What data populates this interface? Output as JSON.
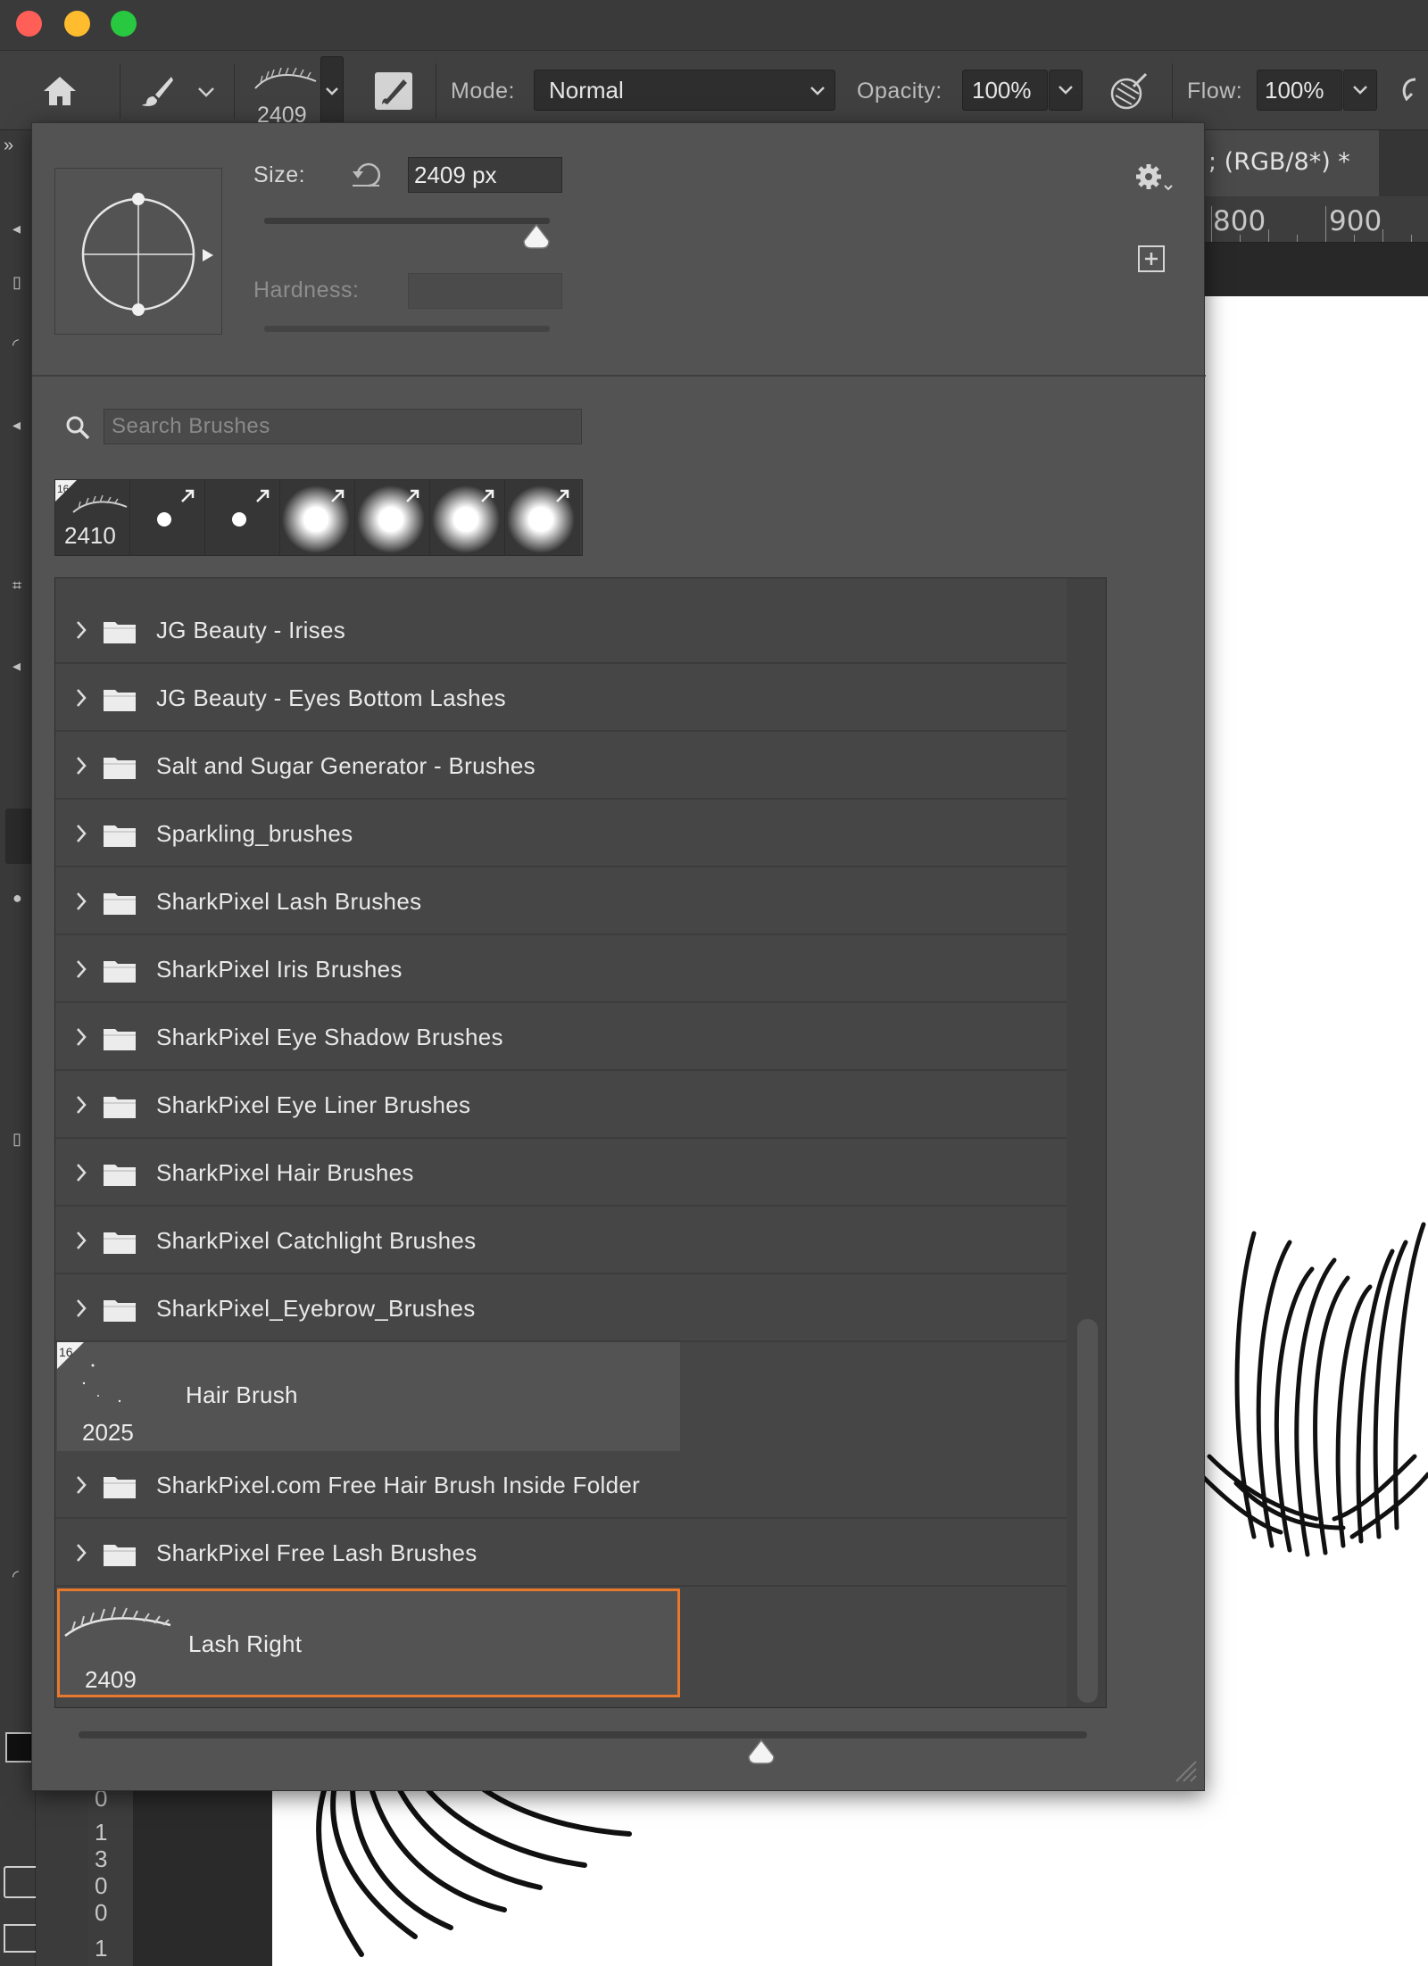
{
  "window": {
    "traffic_lights": [
      "close",
      "minimize",
      "zoom"
    ]
  },
  "options_bar": {
    "brush_size_thumb": "2409",
    "mode_label": "Mode:",
    "mode_value": "Normal",
    "opacity_label": "Opacity:",
    "opacity_value": "100%",
    "flow_label": "Flow:",
    "flow_value": "100%"
  },
  "document": {
    "tab_title": "; (RGB/8*) *",
    "ruler_800": "800",
    "ruler_900": "900",
    "vruler_digits": [
      "0",
      "1",
      "3",
      "0",
      "0",
      "1"
    ]
  },
  "brush_panel": {
    "size_label": "Size:",
    "size_value": "2409 px",
    "hardness_label": "Hardness:",
    "hardness_value": "",
    "search_placeholder": "Search Brushes",
    "recent_brushes": [
      {
        "size": "2410",
        "kind": "lash"
      },
      {
        "size": "",
        "kind": "small-round"
      },
      {
        "size": "",
        "kind": "small-round"
      },
      {
        "size": "",
        "kind": "soft-round"
      },
      {
        "size": "",
        "kind": "soft-round"
      },
      {
        "size": "",
        "kind": "soft-round"
      },
      {
        "size": "",
        "kind": "soft-round"
      }
    ],
    "folders_top": [
      "JG Beauty - Irises",
      "JG Beauty - Eyes Bottom Lashes",
      "Salt and Sugar Generator - Brushes",
      "Sparkling_brushes",
      "SharkPixel Lash Brushes",
      "SharkPixel Iris Brushes",
      "SharkPixel Eye Shadow Brushes",
      "SharkPixel Eye Liner Brushes",
      "SharkPixel Hair Brushes",
      "SharkPixel Catchlight Brushes",
      "SharkPixel_Eyebrow_Brushes"
    ],
    "brush_hair": {
      "name": "Hair Brush",
      "size": "2025"
    },
    "folders_bottom": [
      "SharkPixel.com Free Hair Brush Inside Folder",
      "SharkPixel Free Lash Brushes"
    ],
    "brush_selected": {
      "name": "Lash Right",
      "size": "2409"
    },
    "highlight_color": "#e8792c"
  }
}
